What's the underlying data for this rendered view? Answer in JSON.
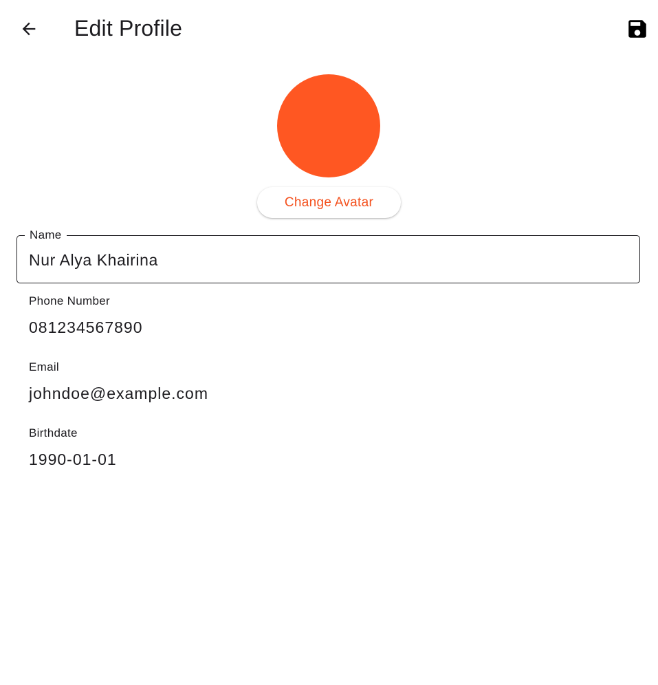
{
  "appbar": {
    "back_icon": "arrow-left-icon",
    "title": "Edit Profile",
    "save_icon": "floppy-disk-icon"
  },
  "avatar": {
    "color": "#ff5722",
    "change_label": "Change Avatar",
    "change_label_color": "#f4511e"
  },
  "form": {
    "name": {
      "label": "Name",
      "value": "Nur Alya Khairina"
    },
    "phone": {
      "label": "Phone Number",
      "value": "081234567890"
    },
    "email": {
      "label": "Email",
      "value": "johndoe@example.com"
    },
    "birthdate": {
      "label": "Birthdate",
      "value": "1990-01-01"
    }
  }
}
